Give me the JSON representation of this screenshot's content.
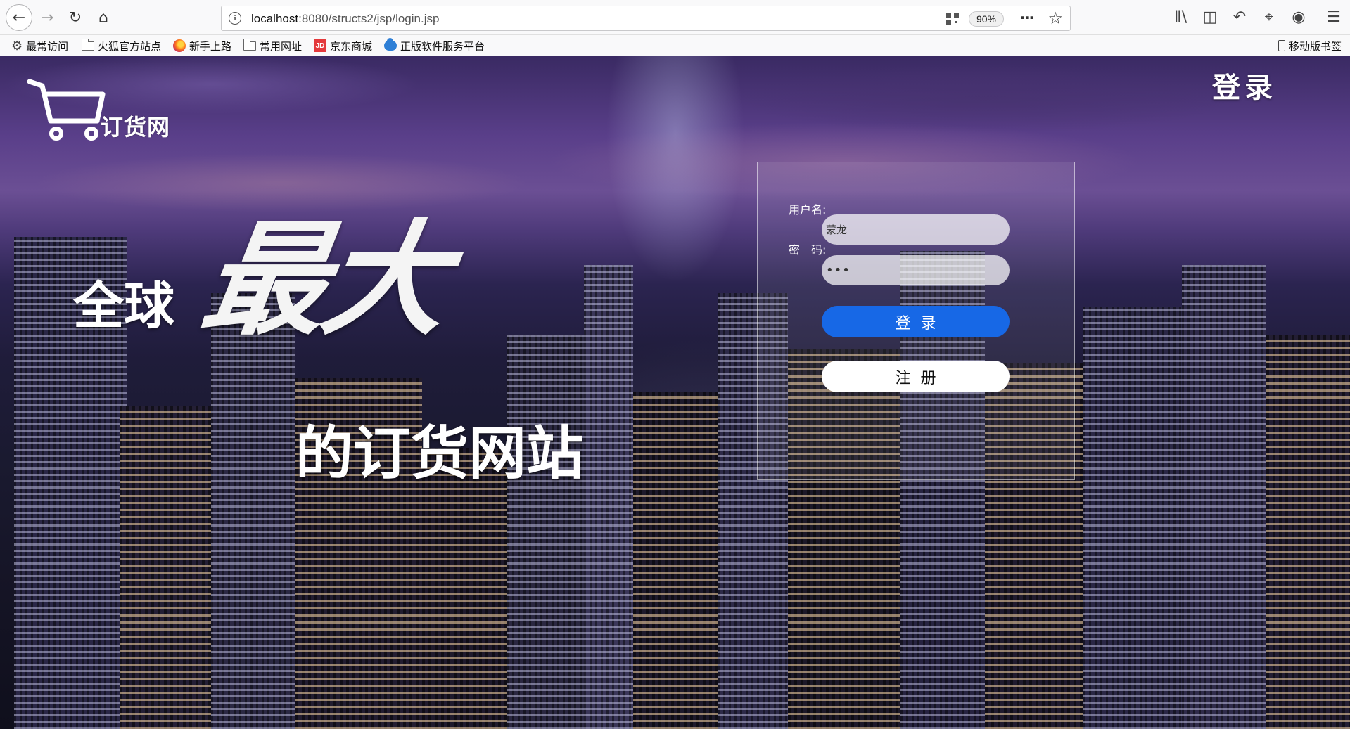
{
  "browser": {
    "url_host": "localhost",
    "url_path": ":8080/structs2/jsp/login.jsp",
    "zoom": "90%",
    "nav_icons": [
      "back-arrow-icon",
      "forward-arrow-icon",
      "reload-icon",
      "home-icon"
    ],
    "toolbar_icons": [
      "library-icon",
      "sidebar-icon",
      "undo-icon",
      "crop-screenshot-icon",
      "chat-bubble-icon",
      "hamburger-menu-icon"
    ]
  },
  "bookmarks": {
    "items": [
      {
        "label": "最常访问",
        "icon": "gear-icon"
      },
      {
        "label": "火狐官方站点",
        "icon": "folder-icon"
      },
      {
        "label": "新手上路",
        "icon": "firefox-icon"
      },
      {
        "label": "常用网址",
        "icon": "folder-icon"
      },
      {
        "label": "京东商城",
        "icon": "jd-icon"
      },
      {
        "label": "正版软件服务平台",
        "icon": "cloud-icon"
      }
    ],
    "mobile_label": "移动版书签"
  },
  "page": {
    "logo_text": "订货网",
    "header_login": "登录",
    "slogan": {
      "global": "全球",
      "biggest": "最大",
      "site": "的订货网站"
    },
    "login_form": {
      "username_label": "用户名:",
      "password_label": "密　码:",
      "username_value": "蒙龙",
      "password_value": "•••",
      "login_button": "登录",
      "register_button": "注册"
    },
    "colors": {
      "login_button": "#1768e6",
      "register_button": "#ffffff"
    }
  }
}
